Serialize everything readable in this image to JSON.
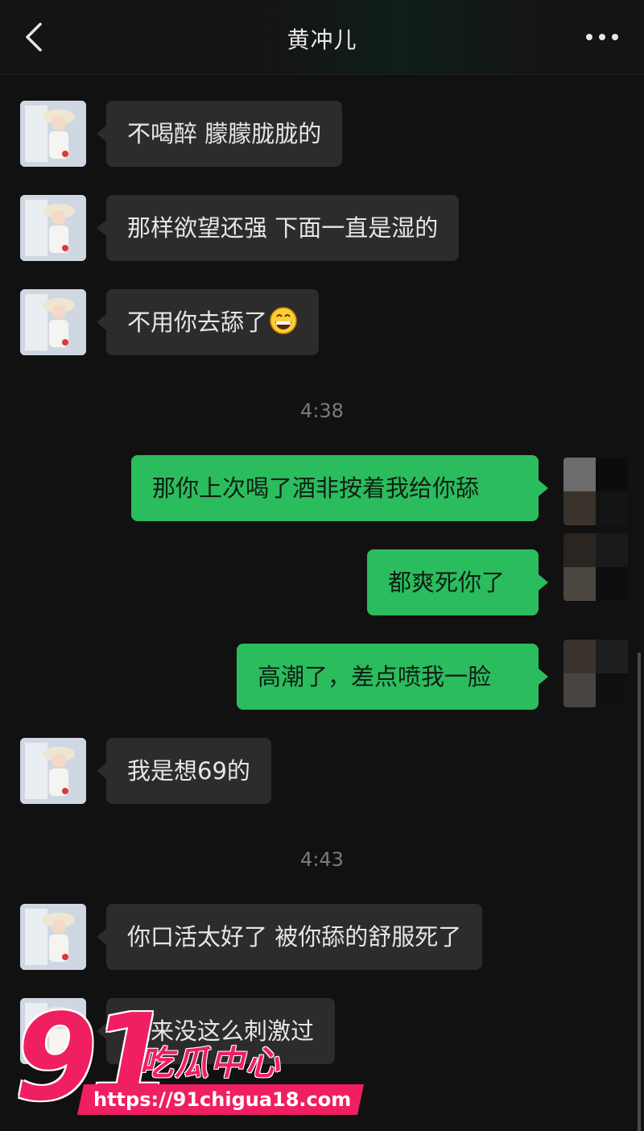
{
  "header": {
    "title": "黄冲儿",
    "back_icon": "chevron-left-icon",
    "more_icon": "more-dots-icon"
  },
  "messages": [
    {
      "side": "in",
      "text": "不喝醉 朦朦胧胧的"
    },
    {
      "side": "in",
      "text": "那样欲望还强 下面一直是湿的"
    },
    {
      "side": "in",
      "text": "不用你去舔了",
      "emoji": "grinning-face-icon"
    },
    {
      "type": "time",
      "text": "4:38"
    },
    {
      "side": "out",
      "text": "那你上次喝了酒非按着我给你舔"
    },
    {
      "side": "out",
      "text": "都爽死你了"
    },
    {
      "side": "out",
      "text": "高潮了，差点喷我一脸"
    },
    {
      "side": "in",
      "text": "我是想69的"
    },
    {
      "type": "time",
      "text": "4:43"
    },
    {
      "side": "in",
      "text": "你口活太好了 被你舔的舒服死了"
    },
    {
      "side": "in",
      "text": "重来没这么刺激过"
    }
  ],
  "watermark": {
    "number": "91",
    "name": "吃瓜中心",
    "url": "https://91chigua18.com"
  },
  "colors": {
    "background": "#111111",
    "bubble_in": "#2c2c2c",
    "bubble_out": "#2bbc5e",
    "watermark": "#ef1f62"
  }
}
